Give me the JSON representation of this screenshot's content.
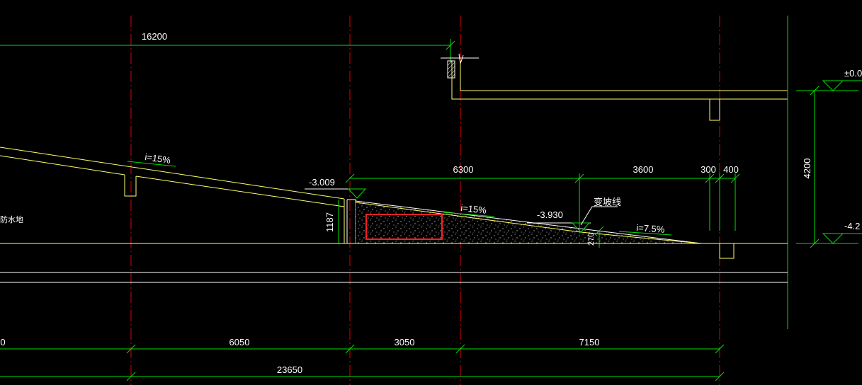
{
  "drawing": {
    "background": "#000000",
    "colors": {
      "axis": "#e00000",
      "dimension": "#00e000",
      "outline": "#ffff66",
      "text": "#ffffff",
      "highlight": "#ff2020"
    },
    "dimensions_top": {
      "total": "16200"
    },
    "dimensions_mid": {
      "a": "6300",
      "b": "3600",
      "c": "300",
      "d": "400"
    },
    "dimensions_right": {
      "height": "4200"
    },
    "dimensions_bottom": {
      "first": "0",
      "s1": "6050",
      "s2": "3050",
      "s3": "7150",
      "total": "23650"
    },
    "elevations": {
      "top_right": "±0.0",
      "bottom_right": "-4.2",
      "ramp_start": "-3.009",
      "slope_change": "-3.930"
    },
    "slopes": {
      "upper_ramp": "i=15%",
      "mid_ramp": "i=15%",
      "lower_ramp": "i=7.5%"
    },
    "labels": {
      "slope_change_line": "变坡线",
      "left_cut": "防水地"
    },
    "local_dims": {
      "wall_height": "1187",
      "step": "270"
    }
  }
}
